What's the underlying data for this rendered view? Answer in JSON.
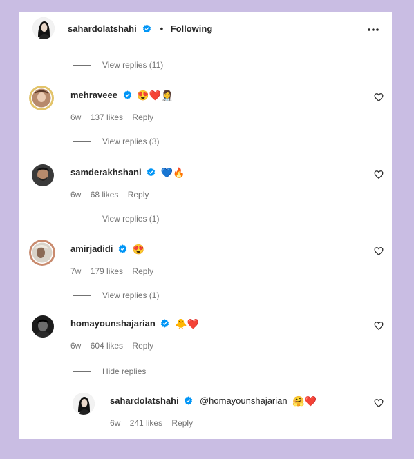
{
  "header": {
    "username": "sahardolatshahi",
    "separator": "•",
    "following_label": "Following",
    "more_icon": "more-horizontal-icon"
  },
  "colors": {
    "background": "#c9bde3",
    "verified": "#0095f6",
    "muted": "#737373",
    "heart": "#e0245e"
  },
  "thread": [
    {
      "type": "view_replies",
      "label": "View replies (11)"
    },
    {
      "type": "comment",
      "username": "mehraveee",
      "emoji": "😍❤️👩‍⚕️",
      "age": "6w",
      "likes": "137 likes",
      "reply": "Reply"
    },
    {
      "type": "view_replies",
      "label": "View replies (3)"
    },
    {
      "type": "comment",
      "username": "samderakhshani",
      "emoji": "💙🔥",
      "age": "6w",
      "likes": "68 likes",
      "reply": "Reply"
    },
    {
      "type": "view_replies",
      "label": "View replies (1)"
    },
    {
      "type": "comment",
      "username": "amirjadidi",
      "emoji": "😍",
      "age": "7w",
      "likes": "179 likes",
      "reply": "Reply"
    },
    {
      "type": "view_replies",
      "label": "View replies (1)"
    },
    {
      "type": "comment",
      "username": "homayounshajarian",
      "emoji": "🐥❤️",
      "age": "6w",
      "likes": "604 likes",
      "reply": "Reply"
    },
    {
      "type": "view_replies",
      "label": "Hide replies"
    },
    {
      "type": "reply",
      "username": "sahardolatshahi",
      "mention": "@homayounshajarian",
      "emoji": "🤗❤️",
      "age": "6w",
      "likes": "241 likes",
      "reply": "Reply"
    }
  ]
}
